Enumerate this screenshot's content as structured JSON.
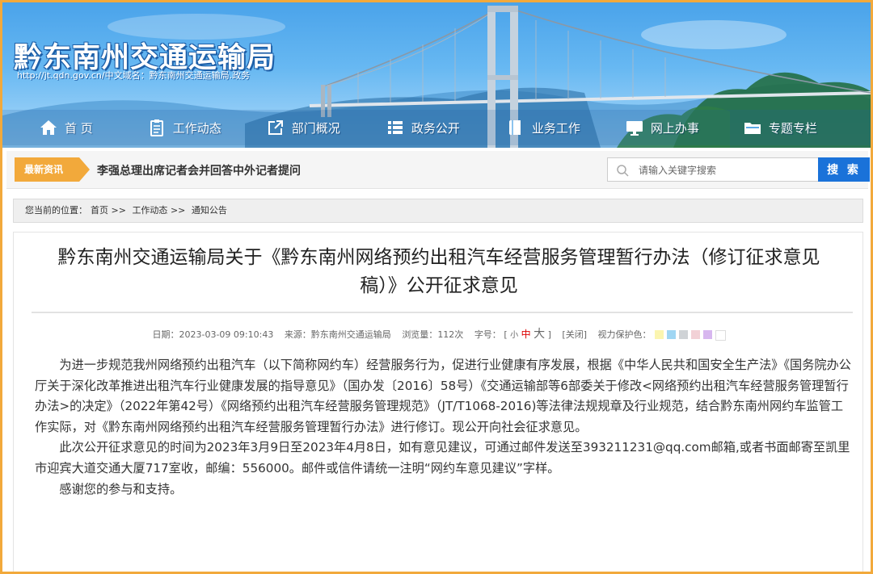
{
  "header": {
    "site_title": "黔东南州交通运输局",
    "site_sub": "http://jt.qdn.gov.cn/中文域名：黔东南州交通运输局.政务"
  },
  "nav": [
    {
      "label": "首 页",
      "icon": "home-icon"
    },
    {
      "label": "工作动态",
      "icon": "clipboard-icon"
    },
    {
      "label": "部门概况",
      "icon": "external-link-icon"
    },
    {
      "label": "政务公开",
      "icon": "list-icon"
    },
    {
      "label": "业务工作",
      "icon": "book-icon"
    },
    {
      "label": "网上办事",
      "icon": "monitor-icon"
    },
    {
      "label": "专题专栏",
      "icon": "folder-icon"
    }
  ],
  "news": {
    "tag": "最新资讯",
    "headline": "李强总理出席记者会并回答中外记者提问"
  },
  "search": {
    "placeholder": "请输入关键字搜索",
    "button": "搜 索"
  },
  "breadcrumb": {
    "prefix": "您当前的位置：",
    "items": [
      "首页",
      ">>",
      "工作动态",
      ">>",
      "通知公告"
    ]
  },
  "article": {
    "title_line1": "黔东南州交通运输局关于《黔东南州网络预约出租汽车经营服务管理暂行办法（修订征求意见",
    "title_line2": "稿）》公开征求意见",
    "date_label": "日期：",
    "date": "2023-03-09 09:10:43",
    "source_label": "来源：",
    "source": "黔东南州交通运输局",
    "views_label": "浏览量：",
    "views": "112次",
    "font_label": "字号：",
    "font_open": "[",
    "font_small": "小",
    "font_mid": "中",
    "font_big": "大",
    "font_close": "]",
    "close_link": "[关闭]",
    "eye_label": "视力保护色：",
    "eye_colors": [
      "#fbf5b0",
      "#9fd6f3",
      "#cfd3d6",
      "#f2d1d6",
      "#d7b7ef",
      "#ffffff"
    ],
    "paragraphs": [
      "为进一步规范我州网络预约出租汽车（以下简称网约车）经营服务行为，促进行业健康有序发展，根据《中华人民共和国安全生产法》《国务院办公厅关于深化改革推进出租汽车行业健康发展的指导意见》（国办发〔2016〕58号）《交通运输部等6部委关于修改<网络预约出租汽车经营服务管理暂行办法>的决定》（2022年第42号）《网络预约出租汽车经营服务管理规范》（JT/T1068-2016)等法律法规规章及行业规范，结合黔东南州网约车监管工作实际，对《黔东南州网络预约出租汽车经营服务管理暂行办法》进行修订。现公开向社会征求意见。",
      "此次公开征求意见的时间为2023年3月9日至2023年4月8日，如有意见建议，可通过邮件发送至393211231@qq.com邮箱,或者书面邮寄至凯里市迎宾大道交通大厦717室收，邮编：556000。邮件或信件请统一注明“网约车意见建议”字样。",
      "感谢您的参与和支持。"
    ]
  }
}
